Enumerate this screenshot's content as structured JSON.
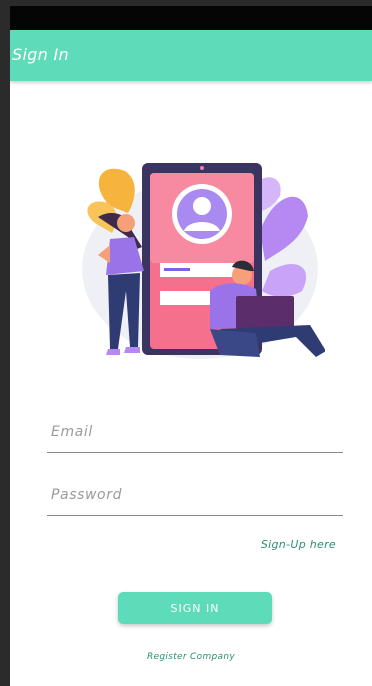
{
  "appbar": {
    "title": "Sign In"
  },
  "form": {
    "email_placeholder": "Email",
    "password_placeholder": "Password",
    "signup_link": "Sign-Up here",
    "signin_button": "SIGN IN",
    "register_link": "Register Company"
  },
  "colors": {
    "accent": "#5edbb8",
    "link": "#2b8f73",
    "statusbar": "#050505"
  },
  "illustration": {
    "icon": "login-illustration"
  }
}
